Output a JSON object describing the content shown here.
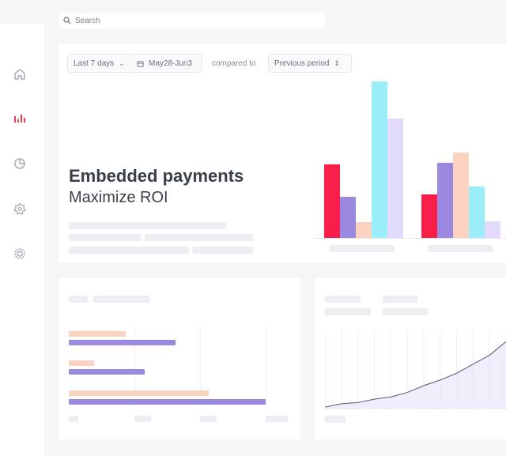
{
  "search": {
    "placeholder": "Search"
  },
  "sidebar": {
    "items": [
      {
        "icon": "home-icon",
        "active": false
      },
      {
        "icon": "bar-chart-icon",
        "active": true
      },
      {
        "icon": "pie-chart-icon",
        "active": false
      },
      {
        "icon": "badge-icon",
        "active": false
      },
      {
        "icon": "settings-icon",
        "active": false
      }
    ]
  },
  "filters": {
    "range_label": "Last 7 days",
    "date_label": "May28-Jun3",
    "compared_label": "compared to",
    "period_label": "Previous period"
  },
  "hero": {
    "title": "Embedded payments",
    "subtitle": "Maximize ROI"
  },
  "colors": {
    "red": "#fa1f4a",
    "purple": "#9b88e0",
    "peach": "#fcd2c0",
    "cyan": "#9aeefa",
    "lavender": "#e4dafb",
    "accent": "#e8263e"
  },
  "chart_data": [
    {
      "type": "bar",
      "title": "",
      "xlabel": "",
      "ylabel": "",
      "categories": [
        "",
        ""
      ],
      "series": [
        {
          "color": "red",
          "values": [
            95,
            56
          ]
        },
        {
          "color": "purple",
          "values": [
            53,
            97
          ]
        },
        {
          "color": "peach",
          "values": [
            20,
            111
          ]
        },
        {
          "color": "cyan",
          "values": [
            203,
            67
          ]
        },
        {
          "color": "lavender",
          "values": [
            155,
            22
          ]
        }
      ],
      "ylim": [
        0,
        210
      ],
      "grid": false,
      "legend": "none"
    },
    {
      "type": "bar",
      "orientation": "horizontal",
      "title": "",
      "categories": [
        "",
        "",
        ""
      ],
      "series": [
        {
          "color": "peach",
          "values": [
            72,
            32,
            177
          ]
        },
        {
          "color": "purple",
          "values": [
            135,
            96,
            249
          ]
        }
      ],
      "xlim": [
        0,
        290
      ],
      "grid": true,
      "legend": "none"
    },
    {
      "type": "line",
      "title": "",
      "x": [
        0,
        1,
        2,
        3,
        4,
        5,
        6,
        7,
        8,
        9,
        10,
        11
      ],
      "series": [
        {
          "color": "purple",
          "values": [
            2,
            5,
            6,
            9,
            11,
            15,
            21,
            26,
            32,
            40,
            48,
            60
          ]
        }
      ],
      "ylim": [
        0,
        70
      ],
      "grid": true,
      "legend": "none"
    }
  ]
}
